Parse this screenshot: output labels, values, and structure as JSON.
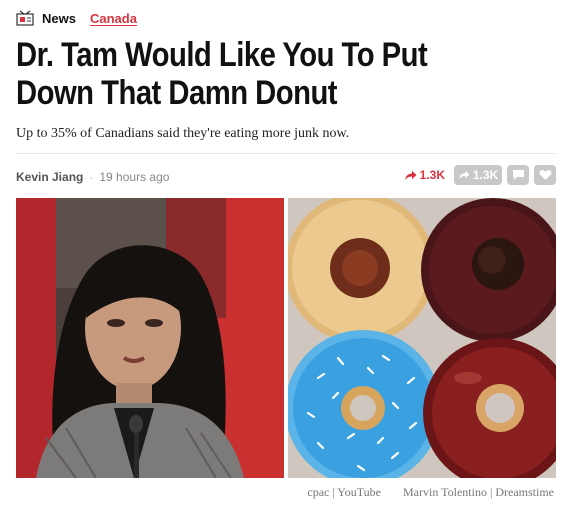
{
  "nav": {
    "news_label": "News",
    "section_label": "Canada"
  },
  "article": {
    "headline": "Dr. Tam Would Like You To Put Down That Damn Donut",
    "subhead": "Up to 35% of Canadians said they're eating more junk now.",
    "author": "Kevin Jiang",
    "separator": "·",
    "time": "19 hours ago"
  },
  "share": {
    "count_red": "1.3K",
    "count_gray": "1.3K",
    "icons": [
      "share-arrow-icon",
      "comment-icon",
      "heart-icon"
    ],
    "accent_color": "#d9333f",
    "pill_color": "#c8c8c8"
  },
  "credits": {
    "left": "cpac | YouTube",
    "right": "Marvin Tolentino | Dreamstime"
  }
}
